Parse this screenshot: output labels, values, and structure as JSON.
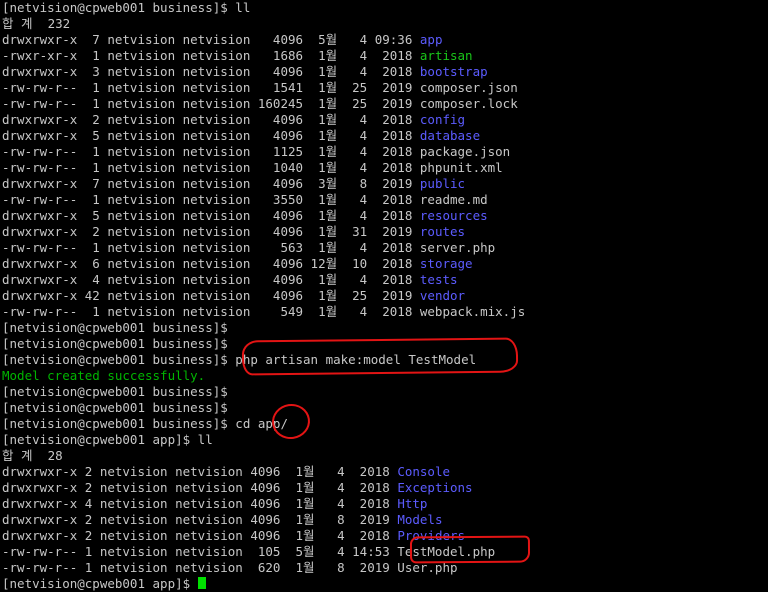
{
  "terminal": {
    "lines": [
      {
        "text": "[netvision@cpweb001 business]$ ll"
      },
      {
        "text": "합 계  232"
      },
      {
        "text": "drwxrwxr-x  7 netvision netvision   4096  5월   4 09:36 ",
        "name": "app",
        "cls": "dir"
      },
      {
        "text": "-rwxr-xr-x  1 netvision netvision   1686  1월   4  2018 ",
        "name": "artisan",
        "cls": "exe"
      },
      {
        "text": "drwxrwxr-x  3 netvision netvision   4096  1월   4  2018 ",
        "name": "bootstrap",
        "cls": "dir"
      },
      {
        "text": "-rw-rw-r--  1 netvision netvision   1541  1월  25  2019 composer.json"
      },
      {
        "text": "-rw-rw-r--  1 netvision netvision 160245  1월  25  2019 composer.lock"
      },
      {
        "text": "drwxrwxr-x  2 netvision netvision   4096  1월   4  2018 ",
        "name": "config",
        "cls": "dir"
      },
      {
        "text": "drwxrwxr-x  5 netvision netvision   4096  1월   4  2018 ",
        "name": "database",
        "cls": "dir"
      },
      {
        "text": "-rw-rw-r--  1 netvision netvision   1125  1월   4  2018 package.json"
      },
      {
        "text": "-rw-rw-r--  1 netvision netvision   1040  1월   4  2018 phpunit.xml"
      },
      {
        "text": "drwxrwxr-x  7 netvision netvision   4096  3월   8  2019 ",
        "name": "public",
        "cls": "dir"
      },
      {
        "text": "-rw-rw-r--  1 netvision netvision   3550  1월   4  2018 readme.md"
      },
      {
        "text": "drwxrwxr-x  5 netvision netvision   4096  1월   4  2018 ",
        "name": "resources",
        "cls": "dir"
      },
      {
        "text": "drwxrwxr-x  2 netvision netvision   4096  1월  31  2019 ",
        "name": "routes",
        "cls": "dir"
      },
      {
        "text": "-rw-rw-r--  1 netvision netvision    563  1월   4  2018 server.php"
      },
      {
        "text": "drwxrwxr-x  6 netvision netvision   4096 12월  10  2018 ",
        "name": "storage",
        "cls": "dir"
      },
      {
        "text": "drwxrwxr-x  4 netvision netvision   4096  1월   4  2018 ",
        "name": "tests",
        "cls": "dir"
      },
      {
        "text": "drwxrwxr-x 42 netvision netvision   4096  1월  25  2019 ",
        "name": "vendor",
        "cls": "dir"
      },
      {
        "text": "-rw-rw-r--  1 netvision netvision    549  1월   4  2018 webpack.mix.js"
      },
      {
        "text": "[netvision@cpweb001 business]$"
      },
      {
        "text": "[netvision@cpweb001 business]$"
      },
      {
        "text": "[netvision@cpweb001 business]$ php artisan make:model TestModel"
      },
      {
        "text": "Model created successfully.",
        "cls_line": "success"
      },
      {
        "text": "[netvision@cpweb001 business]$"
      },
      {
        "text": "[netvision@cpweb001 business]$"
      },
      {
        "text": "[netvision@cpweb001 business]$ cd app/"
      },
      {
        "text": "[netvision@cpweb001 app]$ ll"
      },
      {
        "text": "합 계  28"
      },
      {
        "text": "drwxrwxr-x 2 netvision netvision 4096  1월   4  2018 ",
        "name": "Console",
        "cls": "dir"
      },
      {
        "text": "drwxrwxr-x 2 netvision netvision 4096  1월   4  2018 ",
        "name": "Exceptions",
        "cls": "dir"
      },
      {
        "text": "drwxrwxr-x 4 netvision netvision 4096  1월   4  2018 ",
        "name": "Http",
        "cls": "dir"
      },
      {
        "text": "drwxrwxr-x 2 netvision netvision 4096  1월   8  2019 ",
        "name": "Models",
        "cls": "dir"
      },
      {
        "text": "drwxrwxr-x 2 netvision netvision 4096  1월   4  2018 ",
        "name": "Providers",
        "cls": "dir"
      },
      {
        "text": "-rw-rw-r-- 1 netvision netvision  105  5월   4 14:53 TestModel.php"
      },
      {
        "text": "-rw-rw-r-- 1 netvision netvision  620  1월   8  2019 User.php"
      },
      {
        "text": "[netvision@cpweb001 app]$ ",
        "cursor": true
      }
    ]
  },
  "colors": {
    "background": "#000000",
    "text": "#c7c7c7",
    "directory": "#5c5cff",
    "executable": "#19c519",
    "success": "#00b400",
    "annotation": "#e31414",
    "cursor": "#00e000"
  },
  "annotations": {
    "highlighted": [
      "php artisan make:model TestModel",
      "app/",
      "TestModel.php"
    ]
  }
}
